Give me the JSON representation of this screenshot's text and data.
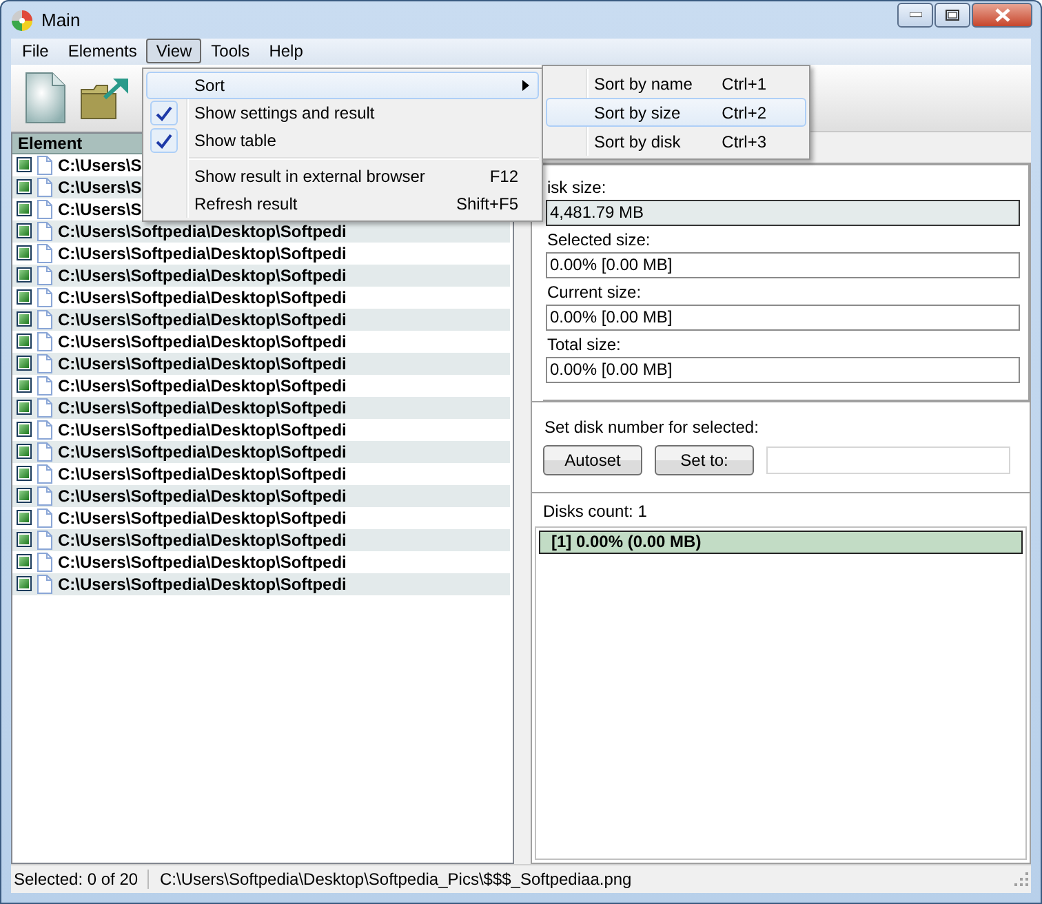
{
  "window": {
    "title": "Main"
  },
  "menu_bar": [
    {
      "label": "File",
      "selected": false
    },
    {
      "label": "Elements",
      "selected": false
    },
    {
      "label": "View",
      "selected": true
    },
    {
      "label": "Tools",
      "selected": false
    },
    {
      "label": "Help",
      "selected": false
    }
  ],
  "view_menu": [
    {
      "kind": "submenu",
      "label": "Sort",
      "selected": true
    },
    {
      "kind": "check",
      "label": "Show settings and result",
      "checked": true,
      "selected": false
    },
    {
      "kind": "check",
      "label": "Show table",
      "checked": true,
      "selected": false
    },
    {
      "kind": "separator"
    },
    {
      "kind": "command",
      "label": "Show result in external browser",
      "shortcut": "F12",
      "selected": false
    },
    {
      "kind": "command",
      "label": "Refresh result",
      "shortcut": "Shift+F5",
      "selected": false
    }
  ],
  "sort_menu": [
    {
      "label": "Sort by name",
      "shortcut": "Ctrl+1",
      "selected": false
    },
    {
      "label": "Sort by size",
      "shortcut": "Ctrl+2",
      "selected": true
    },
    {
      "label": "Sort by disk",
      "shortcut": "Ctrl+3",
      "selected": false
    }
  ],
  "element_table": {
    "column": "Element",
    "rows": [
      {
        "path": "C:\\Users\\S",
        "checked": true
      },
      {
        "path": "C:\\Users\\S",
        "checked": true
      },
      {
        "path": "C:\\Users\\S",
        "checked": true
      },
      {
        "path": "C:\\Users\\Softpedia\\Desktop\\Softpedi",
        "checked": true
      },
      {
        "path": "C:\\Users\\Softpedia\\Desktop\\Softpedi",
        "checked": true
      },
      {
        "path": "C:\\Users\\Softpedia\\Desktop\\Softpedi",
        "checked": true
      },
      {
        "path": "C:\\Users\\Softpedia\\Desktop\\Softpedi",
        "checked": true
      },
      {
        "path": "C:\\Users\\Softpedia\\Desktop\\Softpedi",
        "checked": true
      },
      {
        "path": "C:\\Users\\Softpedia\\Desktop\\Softpedi",
        "checked": true
      },
      {
        "path": "C:\\Users\\Softpedia\\Desktop\\Softpedi",
        "checked": true
      },
      {
        "path": "C:\\Users\\Softpedia\\Desktop\\Softpedi",
        "checked": true
      },
      {
        "path": "C:\\Users\\Softpedia\\Desktop\\Softpedi",
        "checked": true
      },
      {
        "path": "C:\\Users\\Softpedia\\Desktop\\Softpedi",
        "checked": true
      },
      {
        "path": "C:\\Users\\Softpedia\\Desktop\\Softpedi",
        "checked": true
      },
      {
        "path": "C:\\Users\\Softpedia\\Desktop\\Softpedi",
        "checked": true
      },
      {
        "path": "C:\\Users\\Softpedia\\Desktop\\Softpedi",
        "checked": true
      },
      {
        "path": "C:\\Users\\Softpedia\\Desktop\\Softpedi",
        "checked": true
      },
      {
        "path": "C:\\Users\\Softpedia\\Desktop\\Softpedi",
        "checked": true
      },
      {
        "path": "C:\\Users\\Softpedia\\Desktop\\Softpedi",
        "checked": true
      },
      {
        "path": "C:\\Users\\Softpedia\\Desktop\\Softpedi",
        "checked": true
      }
    ]
  },
  "sizes": [
    {
      "kind": "readonly",
      "label": "isk size:",
      "value": "4,481.79 MB"
    },
    {
      "kind": "plain",
      "label": "Selected size:",
      "value": "0.00% [0.00 MB]"
    },
    {
      "kind": "plain",
      "label": "Current size:",
      "value": "0.00% [0.00 MB]"
    },
    {
      "kind": "plain",
      "label": "Total size:",
      "value": "0.00% [0.00 MB]"
    }
  ],
  "disk_number": {
    "label": "Set disk number for selected:",
    "buttons": [
      "Autoset",
      "Set to:"
    ]
  },
  "disks": {
    "count": "Disks count: 1",
    "items": [
      {
        "label": "[1] 0.00% (0.00 MB)"
      }
    ]
  },
  "status_bar": {
    "selection": "Selected: 0 of 20",
    "path": "C:\\Users\\Softpedia\\Desktop\\Softpedia_Pics\\$$$_Softpediaa.png"
  }
}
